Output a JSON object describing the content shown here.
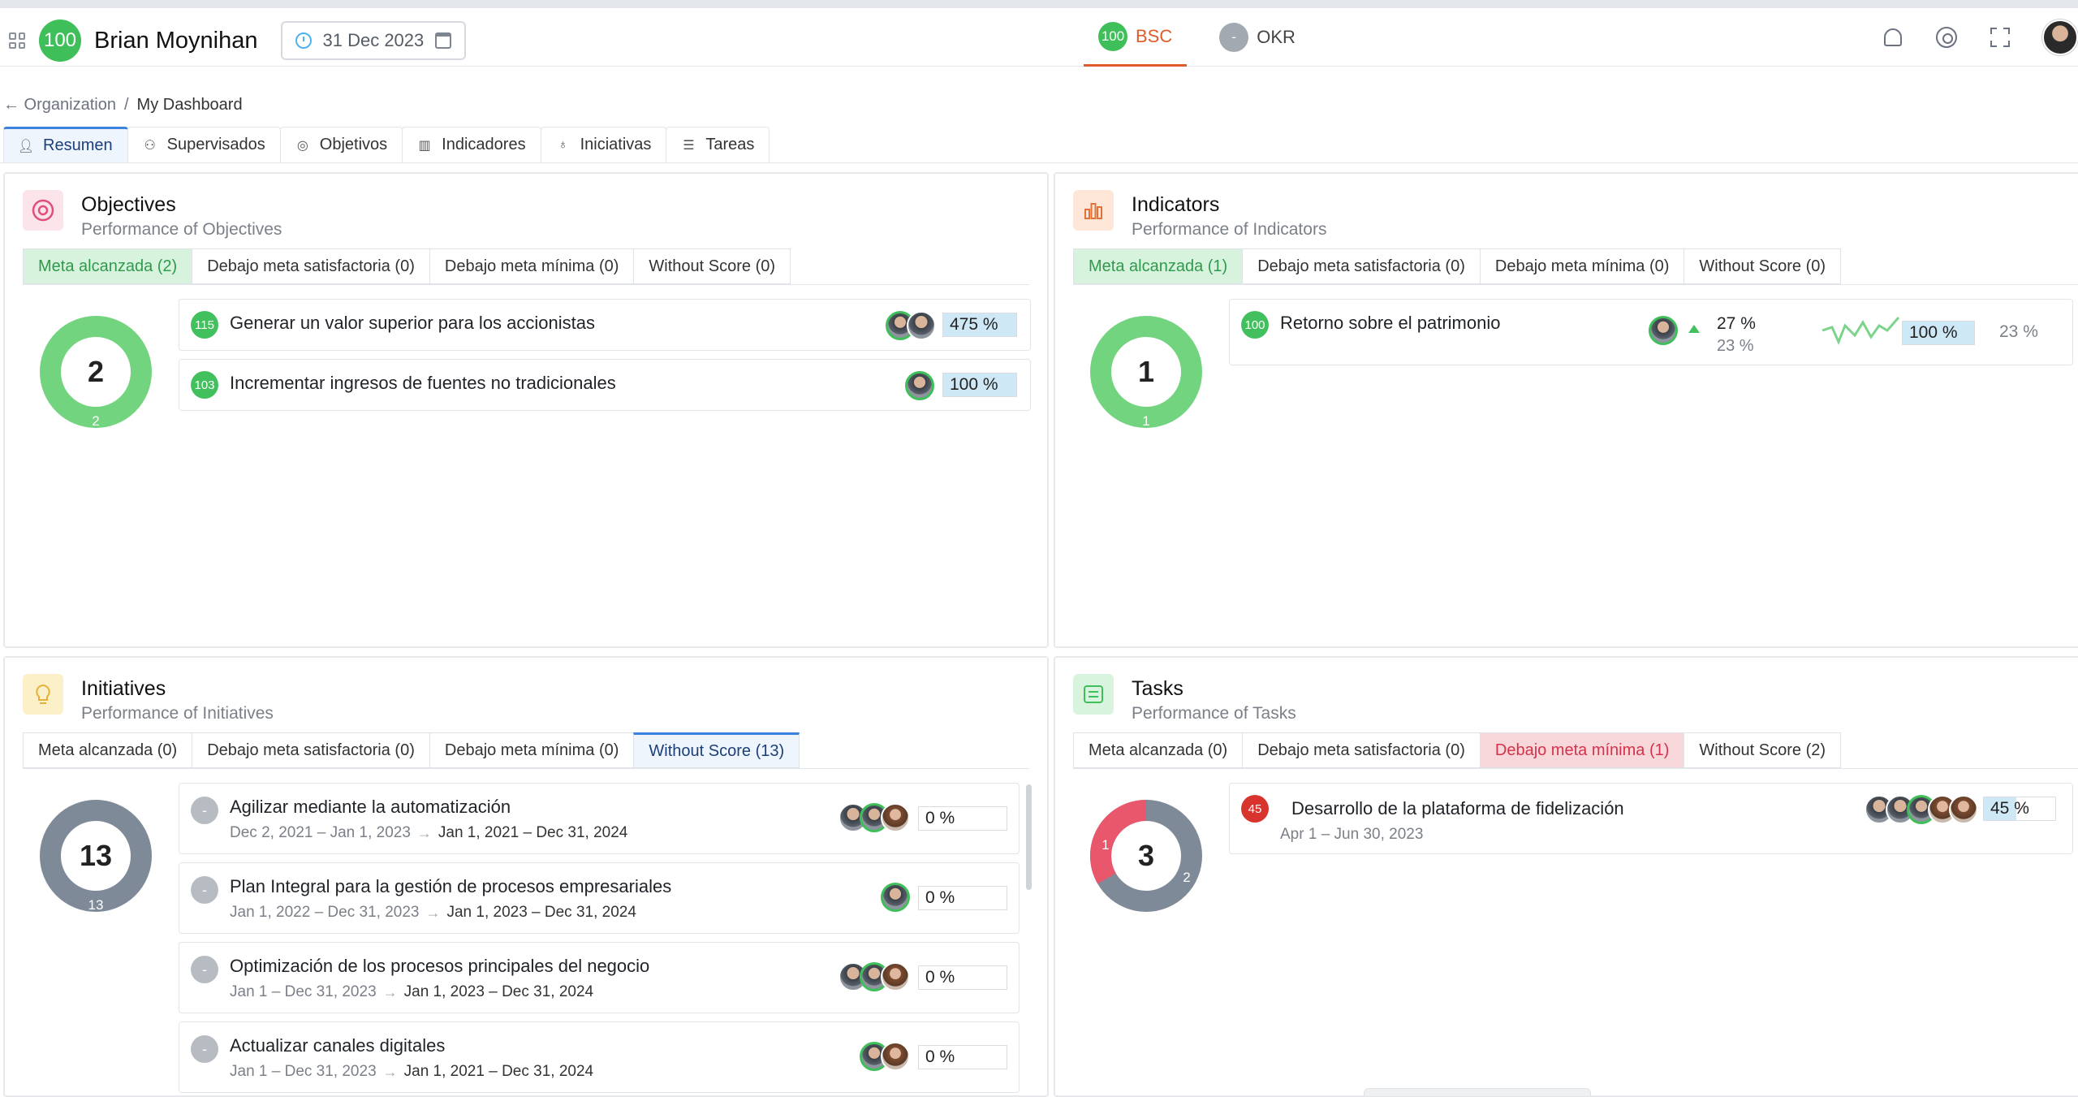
{
  "header": {
    "user_score": "100",
    "user_name": "Brian Moynihan",
    "date": "31 Dec 2023",
    "modes": [
      {
        "badge": "100",
        "label": "BSC"
      },
      {
        "badge": "-",
        "label": "OKR"
      }
    ]
  },
  "breadcrumb": {
    "back": "← Organization",
    "sep": "/",
    "current": "My Dashboard"
  },
  "tabs": [
    "Resumen",
    "Supervisados",
    "Objetivos",
    "Indicadores",
    "Iniciativas",
    "Tareas"
  ],
  "objectives": {
    "title": "Objectives",
    "subtitle": "Performance of Objectives",
    "filters": [
      "Meta alcanzada (2)",
      "Debajo meta satisfactoria (0)",
      "Debajo meta mínima (0)",
      "Without Score (0)"
    ],
    "donut_total": "2",
    "donut_label": "2",
    "items": [
      {
        "score": "115",
        "title": "Generar un valor superior para los accionistas",
        "pct": "475 %",
        "fill": 1.0
      },
      {
        "score": "103",
        "title": "Incrementar ingresos de fuentes no tradicionales",
        "pct": "100 %",
        "fill": 1.0
      }
    ]
  },
  "indicators": {
    "title": "Indicators",
    "subtitle": "Performance of Indicators",
    "filters": [
      "Meta alcanzada (1)",
      "Debajo meta satisfactoria (0)",
      "Debajo meta mínima (0)",
      "Without Score (0)"
    ],
    "donut_total": "1",
    "donut_label": "1",
    "items": [
      {
        "score": "100",
        "title": "Retorno sobre el patrimonio",
        "actual": "27 %",
        "target": "23 %",
        "pct": "100 %",
        "fill": 1.0,
        "extra": "23 %"
      }
    ]
  },
  "initiatives": {
    "title": "Initiatives",
    "subtitle": "Performance of Initiatives",
    "filters": [
      "Meta alcanzada (0)",
      "Debajo meta satisfactoria (0)",
      "Debajo meta mínima (0)",
      "Without Score (13)"
    ],
    "donut_total": "13",
    "donut_label": "13",
    "items": [
      {
        "score": "-",
        "title": "Agilizar mediante la automatización",
        "d1": "Dec 2, 2021 – Jan 1, 2023",
        "d2": "Jan 1, 2021 – Dec 31, 2024",
        "pct": "0 %"
      },
      {
        "score": "-",
        "title": "Plan Integral para la gestión de procesos empresariales",
        "d1": "Jan 1, 2022 – Dec 31, 2023",
        "d2": "Jan 1, 2023 – Dec 31, 2024",
        "pct": "0 %"
      },
      {
        "score": "-",
        "title": "Optimización de los procesos principales del negocio",
        "d1": "Jan 1 – Dec 31, 2023",
        "d2": "Jan 1, 2023 – Dec 31, 2024",
        "pct": "0 %"
      },
      {
        "score": "-",
        "title": "Actualizar canales digitales",
        "d1": "Jan 1 – Dec 31, 2023",
        "d2": "Jan 1, 2021 – Dec 31, 2024",
        "pct": "0 %"
      }
    ]
  },
  "tasks": {
    "title": "Tasks",
    "subtitle": "Performance of Tasks",
    "filters": [
      "Meta alcanzada (0)",
      "Debajo meta satisfactoria (0)",
      "Debajo meta mínima (1)",
      "Without Score (2)"
    ],
    "donut_total": "3",
    "donut_red_label": "1",
    "donut_grey_label": "2",
    "items": [
      {
        "score": "45",
        "title": "Desarrollo de la plataforma de fidelización",
        "d1": "Apr 1 – Jun 30, 2023",
        "pct": "45 %",
        "fill": 0.45
      }
    ]
  },
  "colors": {
    "green": "#3fbf5a",
    "grey": "#7f8a98",
    "red": "#e8576b",
    "accent": "#e05a2a",
    "blue": "#3a82dd"
  }
}
